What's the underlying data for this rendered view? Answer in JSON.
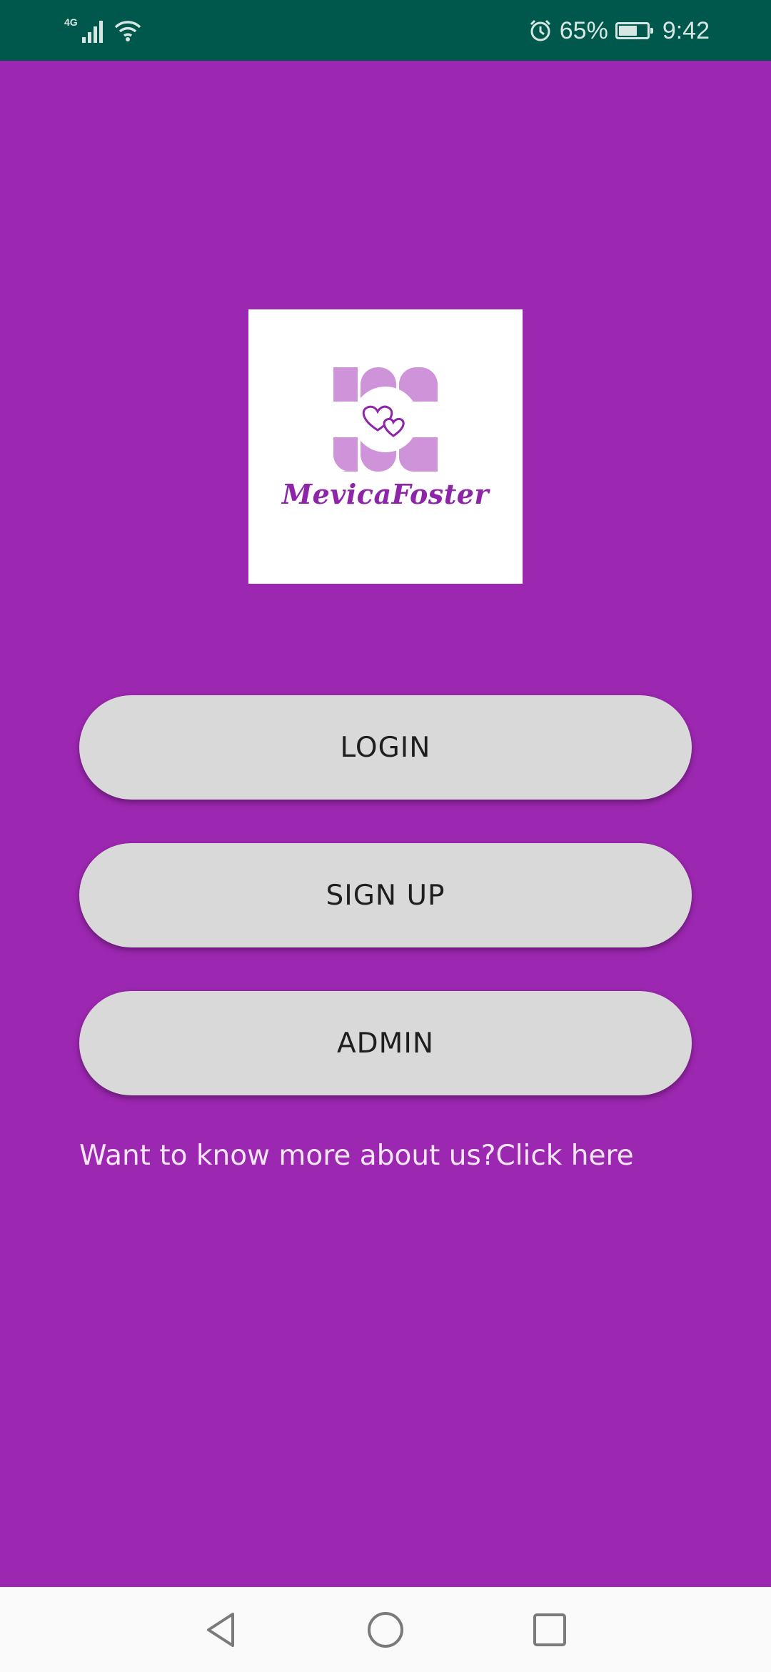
{
  "status_bar": {
    "network_type": "4G",
    "battery_percent": "65%",
    "battery_level": 0.65,
    "time": "9:42",
    "icons": [
      "signal-icon",
      "wifi-icon",
      "alarm-icon",
      "battery-icon"
    ],
    "colors": {
      "background": "#00574b",
      "foreground": "#d6e6e2"
    }
  },
  "logo": {
    "brand_text": "MevicaFoster",
    "mark_icon": "hearts-logo-icon",
    "colors": {
      "mark": "#ce93d8",
      "text": "#8e24aa"
    }
  },
  "buttons": {
    "login": "LOGIN",
    "signup": "SIGN UP",
    "admin": "ADMIN"
  },
  "info_link": "Want to know more about us?Click here",
  "nav_bar": {
    "icons": [
      "back-icon",
      "home-icon",
      "recent-apps-icon"
    ]
  },
  "colors": {
    "background": "#9c27b0",
    "button": "#d9d9d9",
    "button_text": "#1e1e1e"
  }
}
